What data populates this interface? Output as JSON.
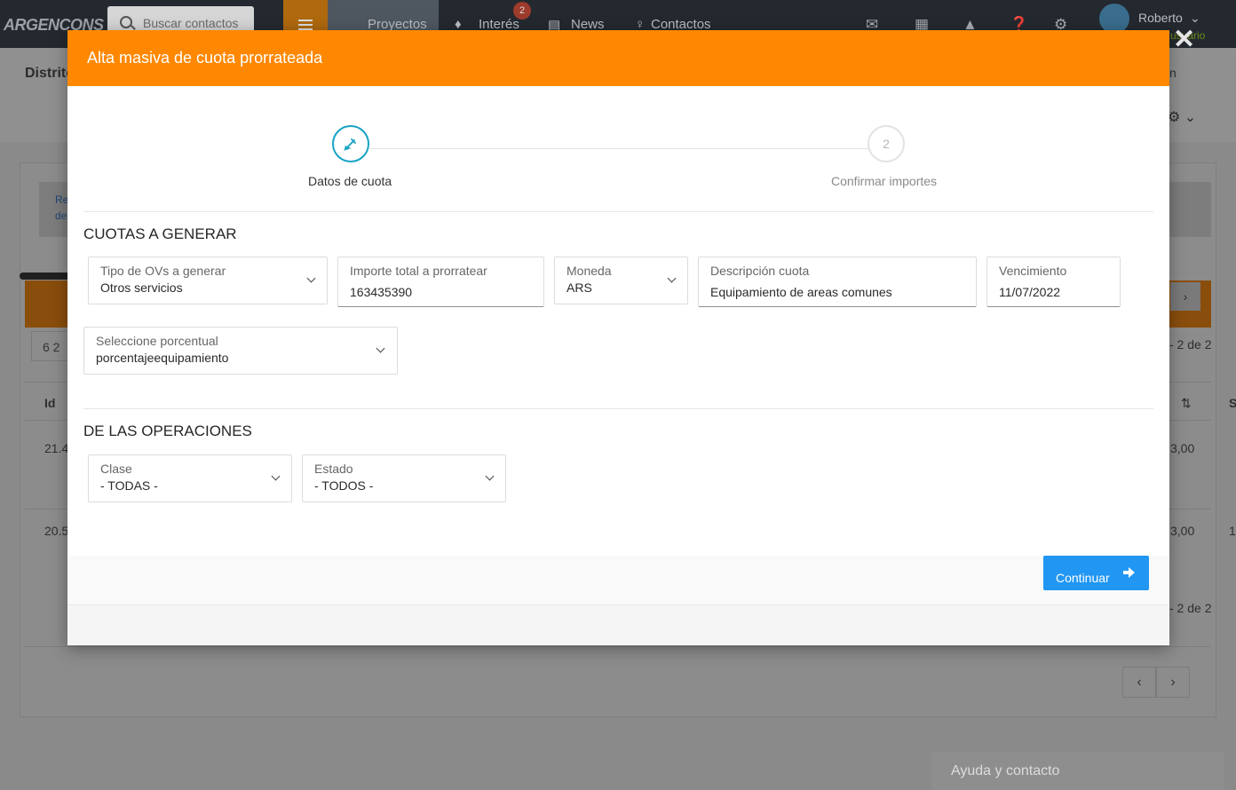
{
  "topbar": {
    "logo": "ARGENCONS",
    "search_placeholder": "Buscar contactos",
    "nav": {
      "proyectos": "Proyectos",
      "interes": "Interés",
      "interes_badge": "2",
      "news": "News",
      "contactos": "Contactos"
    },
    "user": {
      "name": "Roberto",
      "role": "usuario"
    }
  },
  "background": {
    "title": "Distrito",
    "right_text": "n",
    "info_text_1": "Re",
    "info_text_2": "de",
    "count_box": "6 2",
    "pagination_text_top": "- 2 de 2",
    "pagination_text_bottom": "- 2 de 2",
    "col_id": "Id",
    "col_s": "S",
    "rows": [
      {
        "id": "21.4",
        "amount": "3,00"
      },
      {
        "id": "20.5",
        "amount": "3,00",
        "extra": "1"
      }
    ],
    "help": "Ayuda y contacto"
  },
  "modal": {
    "title": "Alta masiva de cuota prorrateada",
    "steps": [
      {
        "label": "Datos de cuota"
      },
      {
        "number": "2",
        "label": "Confirmar importes"
      }
    ],
    "section_cuotas": "CUOTAS A GENERAR",
    "fields": {
      "tipo_ovs": {
        "label": "Tipo de OVs a generar",
        "value": "Otros servicios"
      },
      "importe": {
        "label": "Importe total a prorratear",
        "value": "163435390"
      },
      "moneda": {
        "label": "Moneda",
        "value": "ARS"
      },
      "descripcion": {
        "label": "Descripción cuota",
        "value": "Equipamiento de areas comunes"
      },
      "vencimiento": {
        "label": "Vencimiento",
        "value": "11/07/2022"
      },
      "porcentual": {
        "label": "Seleccione porcentual",
        "value": "porcentajeequipamiento"
      }
    },
    "section_operaciones": "DE LAS OPERACIONES",
    "filters": {
      "clase": {
        "label": "Clase",
        "value": "- TODAS -"
      },
      "estado": {
        "label": "Estado",
        "value": "- TODOS -"
      }
    },
    "continue_label": "Continuar"
  },
  "colors": {
    "accent_orange": "#ff8800",
    "step_active": "#17a2c4",
    "button_blue": "#2196f3"
  }
}
